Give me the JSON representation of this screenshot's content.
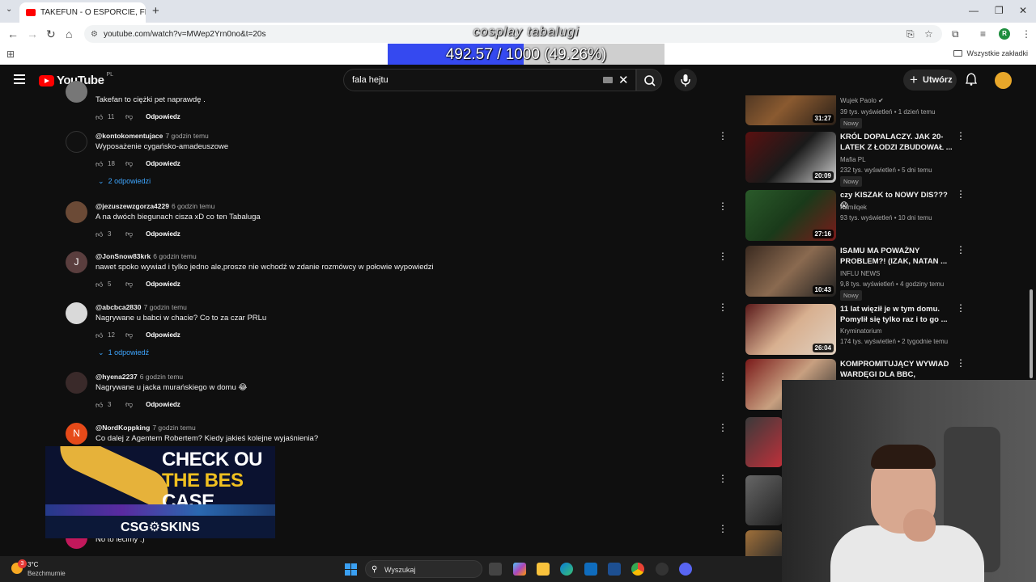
{
  "browser": {
    "tab_title": "TAKEFUN - O ESPORCIE, FREAK",
    "url": "youtube.com/watch?v=MWep2Yrn0no&t=20s",
    "bookmarks_all_label": "Wszystkie zakładki",
    "profile_initial": "R"
  },
  "overlay": {
    "title": "cosplay tabalugi",
    "progress_text": "492.57 / 1000 (49.26%)",
    "progress_fraction": 0.4926
  },
  "youtube": {
    "logo_text": "YouTube",
    "country_code": "PL",
    "search_value": "fala hejtu",
    "create_label": "Utwórz"
  },
  "comments": [
    {
      "author": "",
      "time": "",
      "text": "Takefan to ciężki pet naprawdę .",
      "likes": "11",
      "reply_label": "Odpowiedz",
      "replies": "",
      "avatar": ""
    },
    {
      "author": "@kontokomentujace",
      "time": "7 godzin temu",
      "text": "Wyposażenie cygańsko-amadeuszowe",
      "likes": "18",
      "reply_label": "Odpowiedz",
      "replies": "2 odpowiedzi",
      "avatar": ""
    },
    {
      "author": "@jezuszewzgorza4229",
      "time": "6 godzin temu",
      "text": "A na dwóch biegunach cisza xD co ten Tabaluga",
      "likes": "3",
      "reply_label": "Odpowiedz",
      "replies": "",
      "avatar": ""
    },
    {
      "author": "@JonSnow83krk",
      "time": "6 godzin temu",
      "text": "nawet spoko wywiad i tylko jedno ale,prosze nie wchodź w zdanie rozmówcy w połowie wypowiedzi",
      "likes": "5",
      "reply_label": "Odpowiedz",
      "replies": "",
      "avatar": "J"
    },
    {
      "author": "@abcbca2830",
      "time": "7 godzin temu",
      "text": "Nagrywane u babci w chacie? Co to za czar PRLu",
      "likes": "12",
      "reply_label": "Odpowiedz",
      "replies": "1 odpowiedź",
      "avatar": ""
    },
    {
      "author": "@hyena2237",
      "time": "6 godzin temu",
      "text": "Nagrywane u jacka murańskiego w domu 😂",
      "likes": "3",
      "reply_label": "Odpowiedz",
      "replies": "",
      "avatar": ""
    },
    {
      "author": "@NordKoppking",
      "time": "7 godzin temu",
      "text": "Co dalej z Agentem Robertem? Kiedy jakieś kolejne wyjaśnienia?",
      "likes": "",
      "reply_label": "",
      "replies": "",
      "avatar": "N"
    },
    {
      "author": "",
      "time": "",
      "text": "No to lecimy :)",
      "likes": "",
      "reply_label": "",
      "replies": "",
      "avatar": ""
    }
  ],
  "ad": {
    "headline_1": "CHECK OU",
    "headline_2": "THE BES",
    "headline_3": "CASE",
    "brand": "CSG⚙SKINS"
  },
  "sidebar_videos": [
    {
      "title": "",
      "channel": "Wujek Paolo ✔",
      "meta": "39 tys. wyświetleń • 1 dzień temu",
      "badge": "Nowy",
      "duration": "31:27"
    },
    {
      "title": "KRÓL DOPALACZY. JAK 20-LATEK Z ŁODZI ZBUDOWAŁ ...",
      "channel": "Mafia PL",
      "meta": "232 tys. wyświetleń • 5 dni temu",
      "badge": "Nowy",
      "duration": "20:09"
    },
    {
      "title": "czy KISZAK to NOWY DIS??? 😱",
      "channel": "Kamilqek",
      "meta": "93 tys. wyświetleń • 10 dni temu",
      "badge": "",
      "duration": "27:16"
    },
    {
      "title": "ISAMU MA POWAŻNY PROBLEM?! (IZAK, NATAN ...",
      "channel": "INFLU NEWS",
      "meta": "9,8 tys. wyświetleń • 4 godziny temu",
      "badge": "Nowy",
      "duration": "10:43"
    },
    {
      "title": "11 lat więził je w tym domu. Pomylił się tylko raz i to go ...",
      "channel": "Kryminatorium",
      "meta": "174 tys. wyświetleń • 2 tygodnie temu",
      "badge": "",
      "duration": "26:04"
    },
    {
      "title": "KOMPROMITUJĄCY WYWIAD WARDĘGI DLA BBC, PATOLOGI...",
      "channel": "",
      "meta": "",
      "badge": "",
      "duration": ""
    }
  ],
  "taskbar": {
    "temp": "3°C",
    "condition": "Bezchmurnie",
    "notification_count": "3",
    "search_placeholder": "Wyszukaj"
  },
  "colors": {
    "progress_fill": "#3549f0",
    "youtube_red": "#ff0000",
    "link_blue": "#3ea6ff"
  }
}
